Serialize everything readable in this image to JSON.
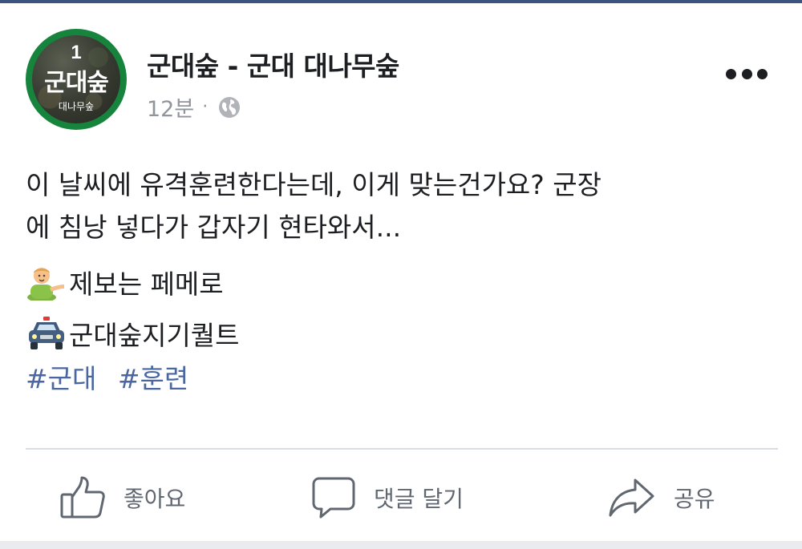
{
  "post": {
    "page_avatar": {
      "number": "1",
      "name": "군대숲",
      "subtitle": "대나무숲"
    },
    "page_name": "군대숲 - 군대 대나무숲",
    "timestamp": "12분",
    "separator": "·",
    "privacy_icon": "globe-icon",
    "more_icon": "more-options-icon",
    "body_line_1": "이 날씨에 유격훈련한다는데, 이게 맞는건가요? 군장",
    "body_line_2": "에 침낭 넣다가 갑자기 현타와서...",
    "emoji_line_1": {
      "icon": "person-tipping-hand-icon",
      "text": "제보는 페메로"
    },
    "emoji_line_2": {
      "icon": "police-car-icon",
      "text": "군대숲지기퀄트"
    },
    "hashtags": [
      "#군대",
      "#훈련"
    ],
    "actions": {
      "like": "좋아요",
      "comment": "댓글 달기",
      "share": "공유"
    }
  },
  "colors": {
    "hashtag": "#4b67a1",
    "avatar_ring": "#17843d",
    "meta_text": "#90949c",
    "action_text": "#606770"
  }
}
